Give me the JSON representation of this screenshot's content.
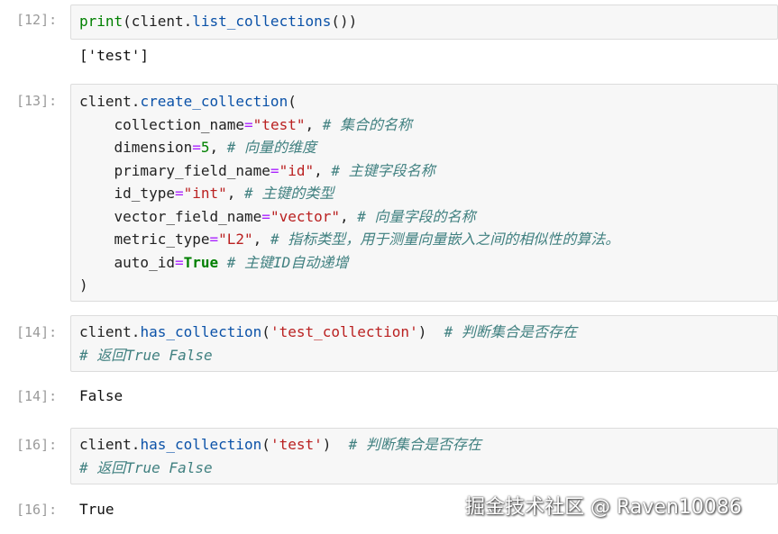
{
  "cells": [
    {
      "prompt": "[12]:",
      "input": {
        "l1": {
          "print": "print",
          "p1": "(client.",
          "fn": "list_collections",
          "p2": "())"
        }
      },
      "output": "['test']"
    },
    {
      "prompt": "[13]:",
      "input": {
        "l1": {
          "obj": "client.",
          "fn": "create_collection",
          "p": "("
        },
        "l2": {
          "k": "    collection_name",
          "eq": "=",
          "s": "\"test\"",
          "c": ", ",
          "cm": "# 集合的名称"
        },
        "l3": {
          "k": "    dimension",
          "eq": "=",
          "n": "5",
          "c": ", ",
          "cm": "# 向量的维度"
        },
        "l4": {
          "k": "    primary_field_name",
          "eq": "=",
          "s": "\"id\"",
          "c": ", ",
          "cm": "# 主键字段名称"
        },
        "l5": {
          "k": "    id_type",
          "eq": "=",
          "s": "\"int\"",
          "c": ", ",
          "cm": "# 主键的类型"
        },
        "l6": {
          "k": "    vector_field_name",
          "eq": "=",
          "s": "\"vector\"",
          "c": ", ",
          "cm": "# 向量字段的名称"
        },
        "l7": {
          "k": "    metric_type",
          "eq": "=",
          "s": "\"L2\"",
          "c": ", ",
          "cm": "# 指标类型，用于测量向量嵌入之间的相似性的算法。"
        },
        "l8": {
          "k": "    auto_id",
          "eq": "=",
          "b": "True",
          "sp": " ",
          "cm": "# 主键ID自动递增"
        },
        "l9": {
          "p": ")"
        }
      }
    },
    {
      "prompt": "[14]:",
      "input": {
        "l1": {
          "obj": "client.",
          "fn": "has_collection",
          "p1": "(",
          "s": "'test_collection'",
          "p2": ")  ",
          "cm": "# 判断集合是否存在"
        },
        "l2": {
          "cm": "# 返回True False"
        }
      },
      "out_prompt": "[14]:",
      "output": "False"
    },
    {
      "prompt": "[16]:",
      "input": {
        "l1": {
          "obj": "client.",
          "fn": "has_collection",
          "p1": "(",
          "s": "'test'",
          "p2": ")  ",
          "cm": "# 判断集合是否存在"
        },
        "l2": {
          "cm": "# 返回True False"
        }
      },
      "out_prompt": "[16]:",
      "output": "True"
    }
  ],
  "watermark": "掘金技术社区 @ Raven10086"
}
